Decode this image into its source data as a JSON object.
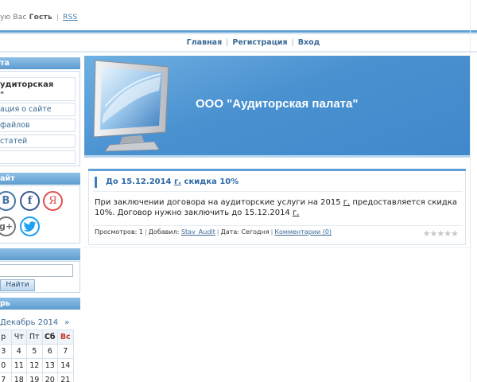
{
  "top": {
    "greeting_prefix": "ую Вас",
    "greeting_name": "Гость",
    "rss": "RSS"
  },
  "nav": [
    "Главная",
    "Регистрация",
    "Вход"
  ],
  "sidebar": {
    "menu_header": "та",
    "menu_items": [
      "удиторская\n\"",
      "ация о сайте",
      "файлов",
      "статей"
    ],
    "social_header": "айт",
    "social_icons": [
      {
        "name": "vk-icon",
        "glyph": "В"
      },
      {
        "name": "facebook-icon",
        "glyph": "f"
      },
      {
        "name": "yandex-icon",
        "glyph": "Я"
      },
      {
        "name": "google-plus-icon",
        "glyph": "g+"
      },
      {
        "name": "twitter-icon",
        "glyph": "🐦"
      }
    ],
    "search_button": "Найти",
    "calendar_header": "рь",
    "calendar": {
      "month": "Декабрь 2014",
      "next_arrow": "»",
      "weekdays": [
        "р",
        "Чт",
        "Пт",
        "Сб",
        "Вс"
      ],
      "rows": [
        [
          "3",
          "4",
          "5",
          "6",
          "7"
        ],
        [
          "0",
          "11",
          "12",
          "13",
          "14"
        ],
        [
          "7",
          "18",
          "19",
          "20",
          "21"
        ]
      ]
    }
  },
  "banner": {
    "title": "ООО \"Аудиторская палата\""
  },
  "post": {
    "title_prefix": "До 15.12.2014 ",
    "title_link": "г.",
    "title_suffix": " скидка 10%",
    "text_1": "При заключении договора на аудиторские услуги на 2015 ",
    "text_link1": "г.",
    "text_2": " предоставляется скидка 10%. Договор нужно заключить до 15.12.2014 ",
    "text_link2": "г.",
    "text_3": "",
    "views_label": "Просмотров: 1",
    "added_label": "Добавил:",
    "author": "Stav_Audit",
    "date_label": "Дата: Сегодня",
    "comments": "Комментарии (0)",
    "rating_stars": "★★★★★"
  },
  "colors": {
    "accent": "#5fa0d6",
    "link": "#3a6a96",
    "banner": "#4a91d0"
  }
}
